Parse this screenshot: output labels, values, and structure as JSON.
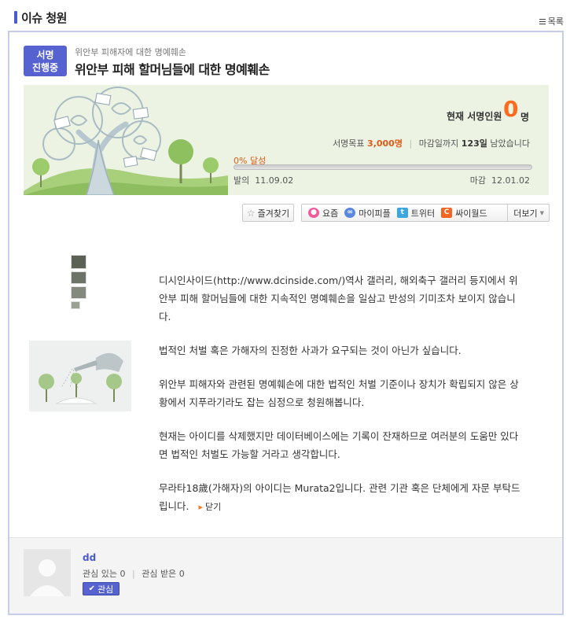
{
  "header": {
    "title": "이슈 청원",
    "list_label": "목록"
  },
  "petition": {
    "status_badge": [
      "서명",
      "진행중"
    ],
    "category": "위안부 피해자에 대한 명예훼손",
    "title": "위안부 피해 할머님들에 대한 명예훼손",
    "current_signers_label": "현재 서명인원",
    "current_signers": "0",
    "current_signers_unit": "명",
    "goal_label": "서명목표",
    "goal_value": "3,000명",
    "deadline_label_pre": "마감일까지",
    "days_left": "123일",
    "deadline_label_post": "남았습니다",
    "progress_percent": 0,
    "progress_text": "0% 달성",
    "start_label": "발의",
    "start_date": "11.09.02",
    "end_label": "마감",
    "end_date": "12.01.02"
  },
  "actions": {
    "favorite": "즐겨찾기",
    "share_items": [
      {
        "label": "요즘",
        "icon": "yozm-icon",
        "color": "#f25a9a"
      },
      {
        "label": "마이피플",
        "icon": "mypeople-icon",
        "color": "#5a88e0"
      },
      {
        "label": "트위터",
        "icon": "twitter-icon",
        "color": "#3aa7e0"
      },
      {
        "label": "싸이월드",
        "icon": "cyworld-icon",
        "color": "#f26522"
      }
    ],
    "more": "더보기"
  },
  "body": {
    "paragraphs": [
      "디시인사이드(http://www.dcinside.com/)역사 갤러리, 해외축구 갤러리 등지에서 위안부 피해 할머님들에 대한 지속적인 명예훼손을 일삼고 반성의 기미조차 보이지 않습니다.",
      "법적인 처벌 혹은 가해자의 진정한 사과가 요구되는 것이 아닌가 싶습니다.",
      "위안부 피해자와 관련된 명예훼손에 대한 법적인 처벌 기준이나 장치가 확립되지 않은 상황에서 지푸라기라도 잡는 심정으로 청원해봅니다.",
      "현재는 아이디를 삭제했지만 데이터베이스에는 기록이 잔재하므로 여러분의 도움만 있다면 법적인 처벌도 가능할 거라고 생각합니다.",
      "무라타18歲(가해자)의 아이디는 Murata2입니다. 관련 기관 혹은 단체에게 자문 부탁드립니다."
    ],
    "close_label": "닫기"
  },
  "author": {
    "name": "dd",
    "interests_label": "관심 있는",
    "interests_count": "0",
    "interested_by_label": "관심 받은",
    "interested_by_count": "0",
    "follow_label": "관심"
  }
}
